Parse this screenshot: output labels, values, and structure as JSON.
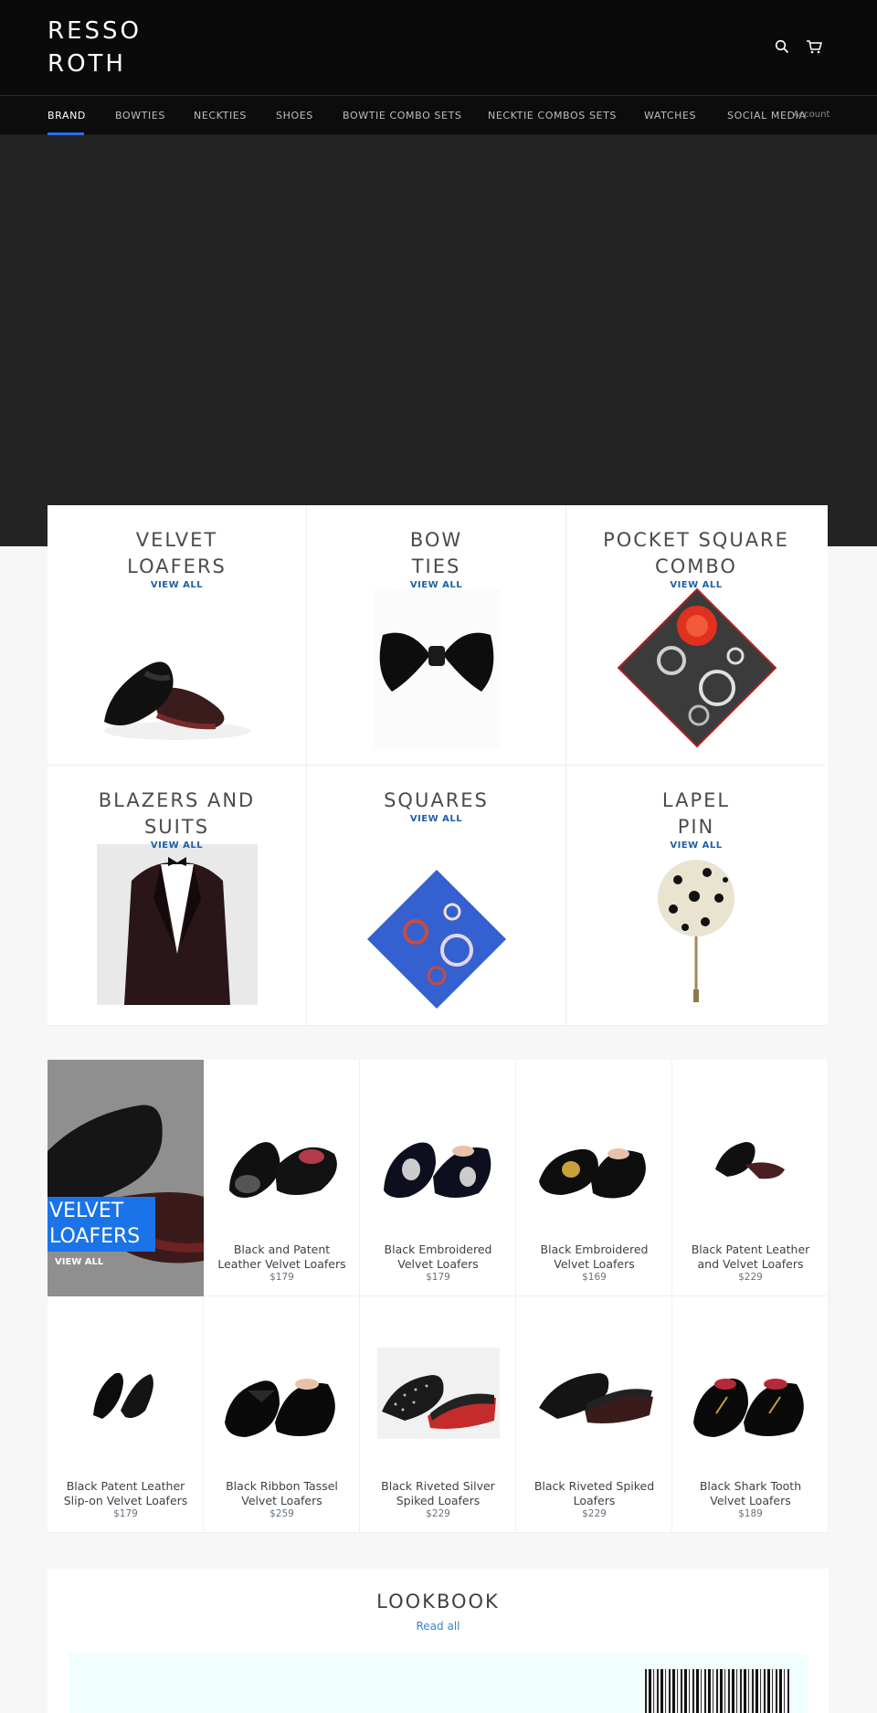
{
  "brand": {
    "name_line1": "RESSO",
    "name_line2": "ROTH"
  },
  "header_icons": {
    "search": "search-icon",
    "cart": "cart-icon"
  },
  "nav": {
    "items": [
      "BRAND",
      "BOWTIES",
      "NECKTIES",
      "SHOES",
      "BOWTIE COMBO SETS",
      "NECKTIE COMBOS SETS",
      "WATCHES",
      "SOCIAL MEDIA"
    ],
    "active": "BRAND",
    "account": "Account"
  },
  "colors": {
    "accent": "#2a6ee8",
    "header_bg": "#0a0a0b",
    "hero_bg": "#232323",
    "link": "#1f5fa8",
    "feature_badge": "#1a73e8"
  },
  "collections": [
    {
      "title1": "VELVET",
      "title2": "LOAFERS",
      "view": "VIEW ALL"
    },
    {
      "title1": "BOW",
      "title2": "TIES",
      "view": "VIEW ALL"
    },
    {
      "title1": "POCKET SQUARE",
      "title2": "COMBO",
      "view": "VIEW ALL"
    },
    {
      "title1": "BLAZERS AND",
      "title2": "SUITS",
      "view": "VIEW ALL"
    },
    {
      "title1": "SQUARES",
      "title2": "",
      "view": "VIEW ALL"
    },
    {
      "title1": "LAPEL",
      "title2": "PIN",
      "view": "VIEW ALL"
    }
  ],
  "featured": {
    "title1": "VELVET",
    "title2": "LOAFERS",
    "view": "VIEW ALL"
  },
  "products": [
    {
      "name1": "Black and Patent",
      "name2": "Leather Velvet Loafers",
      "price": "$179"
    },
    {
      "name1": "Black Embroidered",
      "name2": "Velvet Loafers",
      "price": "$179"
    },
    {
      "name1": "Black Embroidered",
      "name2": "Velvet Loafers",
      "price": "$169"
    },
    {
      "name1": "Black Patent Leather",
      "name2": "and Velvet Loafers",
      "price": "$229"
    },
    {
      "name1": "Black Patent Leather",
      "name2": "Slip-on Velvet Loafers",
      "price": "$179"
    },
    {
      "name1": "Black Ribbon Tassel",
      "name2": "Velvet Loafers",
      "price": "$259"
    },
    {
      "name1": "Black Riveted Silver",
      "name2": "Spiked Loafers",
      "price": "$229"
    },
    {
      "name1": "Black Riveted Spiked",
      "name2": "Loafers",
      "price": "$229"
    },
    {
      "name1": "Black Shark Tooth",
      "name2": "Velvet Loafers",
      "price": "$189"
    }
  ],
  "lookbook": {
    "title": "LOOKBOOK",
    "read": "Read all"
  }
}
